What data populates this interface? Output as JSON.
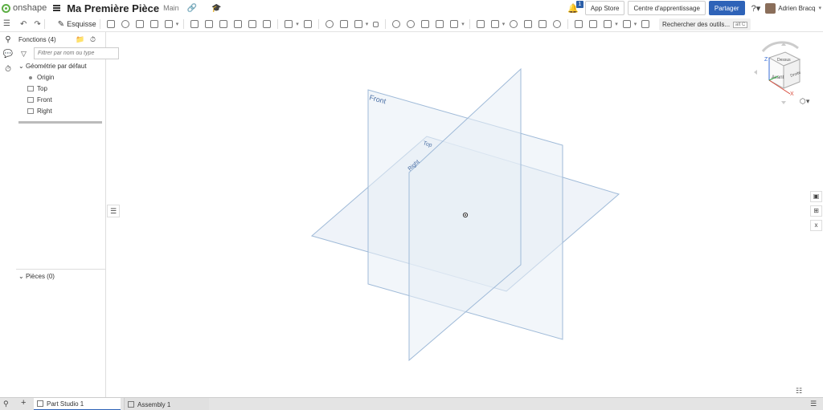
{
  "header": {
    "logo_text": "onshape",
    "doc_title": "Ma Première Pièce",
    "branch": "Main",
    "notification_count": "1",
    "buttons": {
      "app_store": "App Store",
      "learning_center": "Centre d'apprentissage",
      "share": "Partager"
    },
    "user_name": "Adrien Bracq"
  },
  "toolbar": {
    "sketch_label": "Esquisse",
    "search_tools_label": "Rechercher des outils...",
    "search_shortcut": "alt C"
  },
  "panel": {
    "features_title": "Fonctions (4)",
    "filter_placeholder": "Filtrer par nom ou type",
    "default_geometry": "Géométrie par défaut",
    "items": [
      "Origin",
      "Top",
      "Front",
      "Right"
    ],
    "parts_title": "Pièces (0)"
  },
  "viewport": {
    "planes": {
      "front": "Front",
      "top": "Top",
      "right": "Right"
    },
    "viewcube": {
      "top": "Dessus",
      "front": "Avant",
      "right": "Droite",
      "axis_x": "X",
      "axis_z": "Z"
    }
  },
  "tabs": [
    "Part Studio 1",
    "Assembly 1"
  ],
  "colors": {
    "accent": "#2e63b8",
    "plane_fill": "#e8eef6",
    "plane_stroke": "#9fbad8",
    "plane_label": "#4a6fa5",
    "logo_green": "#5cae44"
  }
}
